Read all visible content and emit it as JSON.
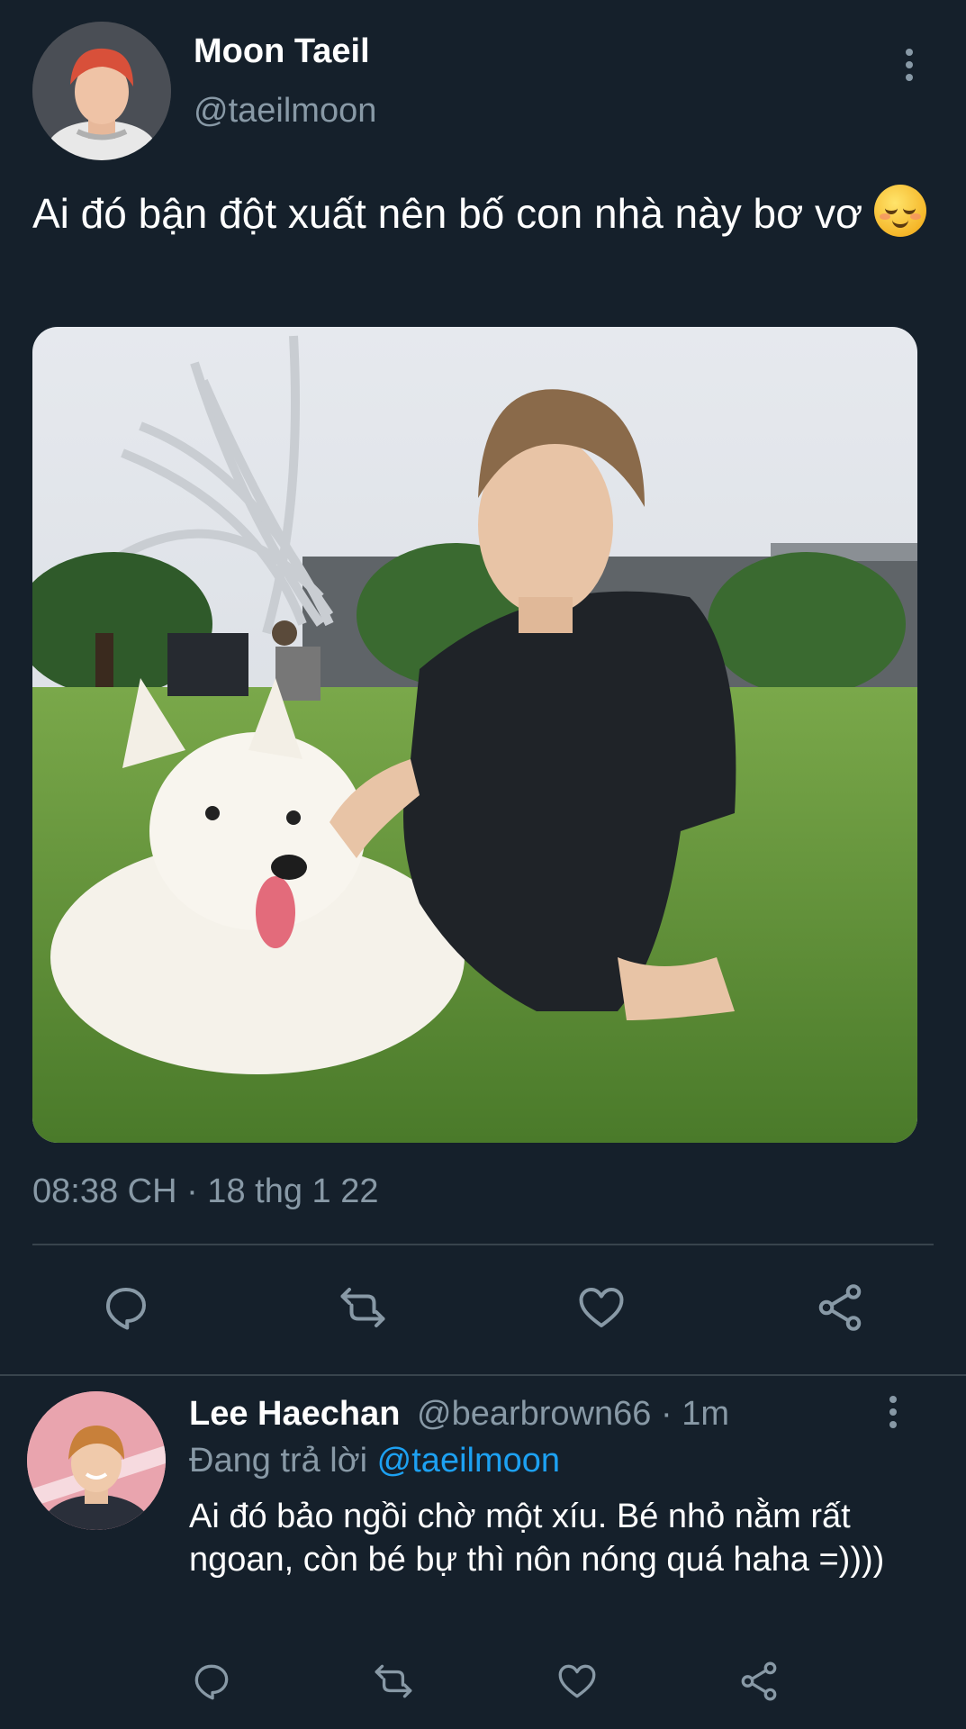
{
  "tweet": {
    "author_name": "Moon Taeil",
    "author_handle": "@taeilmoon",
    "text": "Ai đó bận đột xuất nên bố con nhà này bơ vơ",
    "emoji": "relieved-face",
    "timestamp": "08:38 CH · 18 thg 1 22",
    "actions": [
      "reply-icon",
      "retweet-icon",
      "like-icon",
      "share-icon"
    ]
  },
  "reply": {
    "author_name": "Lee Haechan",
    "author_handle": "@bearbrown66",
    "time": "1m",
    "meta_separator": "·",
    "replying_prefix": "Đang trả lời",
    "replying_to": "@taeilmoon",
    "text": "Ai đó bảo ngồi chờ một xíu. Bé nhỏ nằm rất ngoan, còn bé bự thì nôn nóng quá haha =))))"
  },
  "colors": {
    "background": "#15202b",
    "secondary_text": "#8899a6",
    "mention": "#1da1f2",
    "divider": "#38444d"
  }
}
